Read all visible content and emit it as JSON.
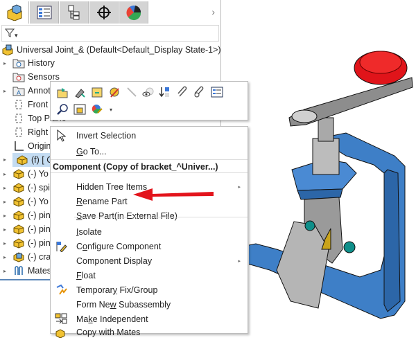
{
  "tabs": [
    {
      "name": "feature-manager"
    },
    {
      "name": "property-manager"
    },
    {
      "name": "configuration-manager"
    },
    {
      "name": "dimxpert-manager"
    },
    {
      "name": "display-manager"
    }
  ],
  "filter": {
    "icon": "funnel-icon",
    "symbol": "▾"
  },
  "tree": {
    "root": "Universal Joint_&  (Default<Default_Display State-1>)",
    "items": [
      {
        "label": "History",
        "icon": "folder-history-icon",
        "expand": true
      },
      {
        "label": "Sensors",
        "icon": "folder-sensors-icon",
        "expand": false
      },
      {
        "label": "Annot",
        "icon": "folder-annotations-icon",
        "expand": true
      },
      {
        "label": "Front",
        "icon": "plane-icon",
        "expand": false
      },
      {
        "label": "Top Plane",
        "icon": "plane-icon",
        "expand": false
      },
      {
        "label": "Right",
        "icon": "plane-icon",
        "expand": false
      },
      {
        "label": "Origin",
        "icon": "origin-icon",
        "expand": false
      },
      {
        "label": "(f) [ C",
        "icon": "component-icon",
        "expand": true,
        "selected": true
      },
      {
        "label": "(-) Yo",
        "icon": "component-icon",
        "expand": true
      },
      {
        "label": "(-) spi",
        "icon": "component-icon",
        "expand": true
      },
      {
        "label": "(-) Yo",
        "icon": "component-icon",
        "expand": true
      },
      {
        "label": "(-) pin",
        "icon": "component-icon",
        "expand": true
      },
      {
        "label": "(-) pin",
        "icon": "component-icon",
        "expand": true
      },
      {
        "label": "(-) pin",
        "icon": "component-icon",
        "expand": true
      },
      {
        "label": "(-) cra",
        "icon": "subassembly-icon",
        "expand": true
      },
      {
        "label": "Mates",
        "icon": "mates-icon",
        "expand": true
      }
    ]
  },
  "menu": {
    "top": [
      {
        "label": "Invert Selection"
      },
      {
        "pre": "",
        "u": "G",
        "post": "o To..."
      }
    ],
    "header": "Component (Copy of bracket_^Univer...)",
    "items": [
      {
        "pre": "Hidden Tree Items",
        "u": "",
        "post": "",
        "submenu": true
      },
      {
        "pre": "",
        "u": "R",
        "post": "ename Part"
      },
      {
        "pre": "",
        "u": "S",
        "post": "ave Part(in External File)"
      },
      {
        "pre": "",
        "u": "I",
        "post": "solate"
      },
      {
        "pre": "C",
        "u": "o",
        "post": "nfigure Component",
        "icon": "configure-icon"
      },
      {
        "pre": "Component Display",
        "u": "",
        "post": "",
        "submenu": true
      },
      {
        "pre": "",
        "u": "F",
        "post": "loat"
      },
      {
        "pre": "Temporar",
        "u": "y",
        "post": " Fix/Group",
        "icon": "fix-group-icon"
      },
      {
        "pre": "Form Ne",
        "u": "w",
        "post": " Subassembly"
      },
      {
        "pre": "Ma",
        "u": "k",
        "post": "e Independent",
        "icon": "make-independent-icon"
      },
      {
        "pre": "Copy with Mates",
        "u": "",
        "post": "",
        "icon": "copy-mates-icon"
      }
    ],
    "submenu_arrow": "▸"
  },
  "colors": {
    "accent": "#e3141c",
    "selection": "#c4dcf2",
    "bracket": "#3f7fc8",
    "knob": "#e0141a"
  }
}
